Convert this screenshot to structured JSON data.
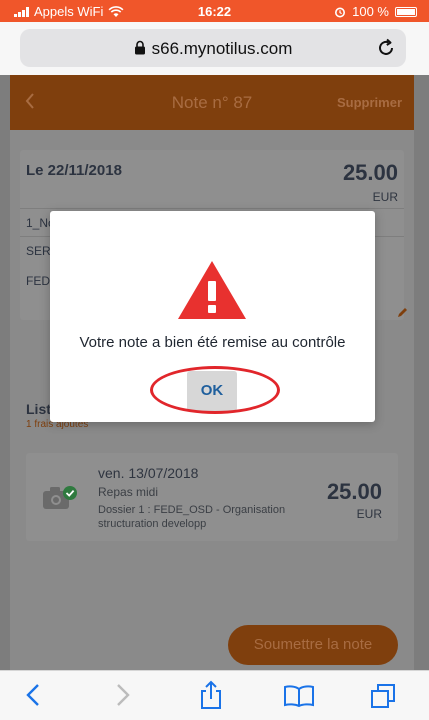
{
  "status_bar": {
    "carrier": "Appels WiFi",
    "time": "16:22",
    "battery_percent": "100 %",
    "battery_level": 1.0
  },
  "browser": {
    "url": "s66.mynotilus.com",
    "icons": [
      "lock-icon",
      "reload-icon"
    ]
  },
  "app_header": {
    "title": "Note n° 87",
    "delete_label": "Supprimer",
    "color": "#c7651b"
  },
  "summary": {
    "date": "Le 22/11/2018",
    "amount": "25.00",
    "currency": "EUR",
    "line1": "1_No",
    "line2": "SER",
    "line3": "FEDE"
  },
  "list": {
    "title": "List",
    "subtitle": "1 frais ajoutés"
  },
  "expense": {
    "date": "ven. 13/07/2018",
    "category": "Repas midi",
    "folder": "Dossier 1 : FEDE_OSD - Organisation structuration developp",
    "amount": "25.00",
    "currency": "EUR"
  },
  "footer": {
    "submit_label": "Soumettre la note"
  },
  "modal": {
    "message": "Votre note a bien été remise au contrôle",
    "ok_label": "OK",
    "warning_color": "#e8312f",
    "highlight_color": "#e1262b"
  },
  "toolbar": {
    "icons": [
      "back-icon",
      "forward-icon",
      "share-icon",
      "bookmarks-icon",
      "tabs-icon"
    ],
    "accent": "#1a73e8"
  }
}
